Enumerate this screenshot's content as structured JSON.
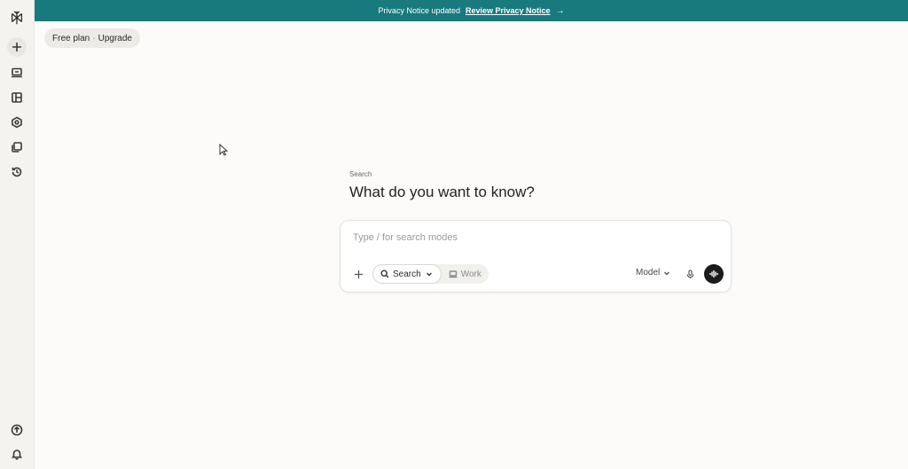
{
  "banner": {
    "text": "Privacy Notice updated",
    "link": "Review Privacy Notice",
    "arrow": "→"
  },
  "plan": {
    "free": "Free plan",
    "separator": "·",
    "upgrade": "Upgrade"
  },
  "main": {
    "label": "Search",
    "headline": "What do you want to know?"
  },
  "composer": {
    "placeholder": "Type / for search modes",
    "modes": [
      {
        "label": "Search",
        "icon": "search-icon",
        "active": true
      },
      {
        "label": "Work",
        "icon": "laptop-icon",
        "active": false
      }
    ],
    "model_label": "Model"
  },
  "sidebar": {
    "items": [
      {
        "icon": "logo-icon"
      },
      {
        "icon": "plus-icon"
      },
      {
        "icon": "computer-icon"
      },
      {
        "icon": "layout-icon"
      },
      {
        "icon": "discover-icon"
      },
      {
        "icon": "spaces-icon"
      },
      {
        "icon": "history-icon"
      },
      {
        "icon": "upgrade-arrow-icon"
      },
      {
        "icon": "bell-icon"
      }
    ]
  },
  "colors": {
    "banner_bg": "#187a7c",
    "page_bg": "#fcfbf9",
    "sidebar_bg": "#f4f3ef",
    "voice_button": "#1c1c1c"
  }
}
